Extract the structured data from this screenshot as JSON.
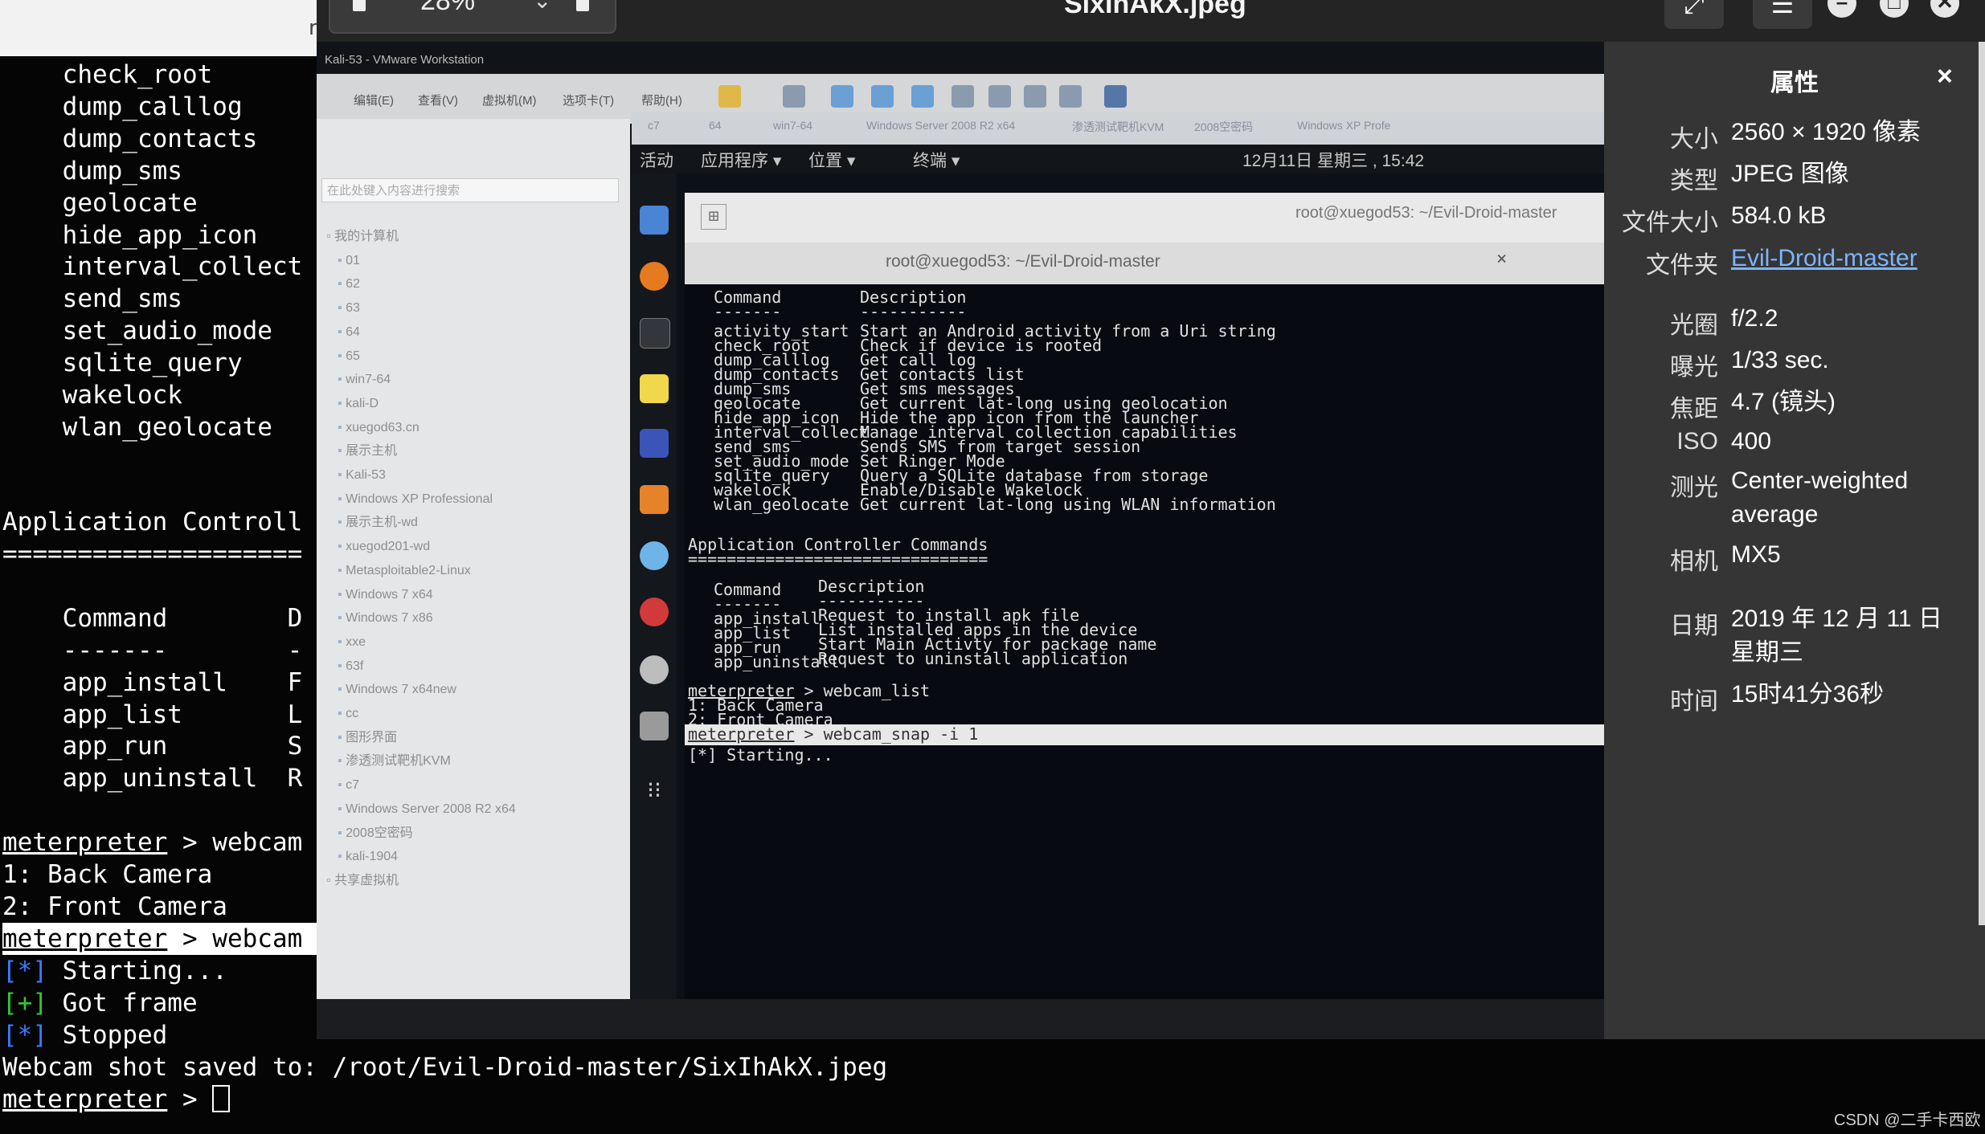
{
  "terminal": {
    "list1": [
      "check_root",
      "dump_calllog",
      "dump_contacts",
      "dump_sms",
      "geolocate",
      "hide_app_icon",
      "interval_collect",
      "send_sms",
      "set_audio_mode",
      "sqlite_query",
      "wakelock",
      "wlan_geolocate"
    ],
    "section": "Application Controll",
    "divider": "====================",
    "col_command": "Command",
    "col_desc_initial": "D",
    "col_underline": "-------",
    "col_desc_underline": "-",
    "apps": [
      {
        "cmd": "app_install",
        "d": "F"
      },
      {
        "cmd": "app_list",
        "d": "L"
      },
      {
        "cmd": "app_run",
        "d": "S"
      },
      {
        "cmd": "app_uninstall",
        "d": "R"
      }
    ],
    "prompt": "meterpreter",
    "webcam_cmd": " > webcam",
    "cam1": "1: Back Camera",
    "cam2": "2: Front Camera",
    "starting_tag": "[*]",
    "starting": " Starting...",
    "got_tag": "[+]",
    "got": " Got frame",
    "stopped_tag": "[*]",
    "stopped": " Stopped",
    "saved": "Webcam shot saved to: /root/Evil-Droid-master/SixIhAkX.jpeg",
    "final_prompt_suffix": " > ",
    "r_char": "r"
  },
  "viewer": {
    "zoom": "28%",
    "zoom_chevron": "⌄",
    "title": "SixIhAkX.jpeg",
    "btn_fullscreen": "⤢",
    "btn_menu": "☰",
    "btn_min": "–",
    "btn_max": "□",
    "btn_close": "✕"
  },
  "photo": {
    "vm_title": "Kali-53 - VMware Workstation",
    "menu": [
      "编辑(E)",
      "查看(V)",
      "虚拟机(M)",
      "选项卡(T)",
      "帮助(H)"
    ],
    "lib_search": "在此处键入内容进行搜索",
    "tree_root": "我的计算机",
    "tree": [
      "01",
      "62",
      "63",
      "64",
      "65",
      "win7-64",
      "kali-D",
      "xuegod63.cn",
      "展示主机",
      "Kali-53",
      "Windows XP Professional",
      "展示主机-wd",
      "xuegod201-wd",
      "Metasploitable2-Linux",
      "Windows 7 x64",
      "Windows 7 x86",
      "xxe",
      "63f",
      "Windows 7 x64new",
      "cc",
      "图形界面",
      "渗透测试靶机KVM",
      "c7",
      "Windows Server 2008 R2 x64",
      "2008空密码",
      "kali-1904"
    ],
    "tree_shared": "共享虚拟机",
    "tabs": [
      "c7",
      "64",
      "win7-64",
      "Windows Server 2008 R2 x64",
      "渗透测试靶机KVM",
      "2008空密码",
      "Windows XP Profe"
    ],
    "kali_activities": "活动",
    "kali_apps": "应用程序 ▾",
    "kali_places": "位置 ▾",
    "kali_term": "终端 ▾",
    "kali_clock": "12月11日 星期三 , 15:42",
    "term_title_back": "root@xuegod53: ~/Evil-Droid-master",
    "term_title_front": "root@xuegod53: ~/Evil-Droid-master",
    "term_close": "×",
    "plus": "⊞",
    "hdr_command": "Command",
    "hdr_desc": "Description",
    "underline_cmd": "-------",
    "underline_desc": "-----------",
    "cmds": [
      {
        "c": "activity_start",
        "d": "Start an Android activity from a Uri string"
      },
      {
        "c": "check_root",
        "d": "Check if device is rooted"
      },
      {
        "c": "dump_calllog",
        "d": "Get call log"
      },
      {
        "c": "dump_contacts",
        "d": "Get contacts list"
      },
      {
        "c": "dump_sms",
        "d": "Get sms messages"
      },
      {
        "c": "geolocate",
        "d": "Get current lat-long using geolocation"
      },
      {
        "c": "hide_app_icon",
        "d": "Hide the app icon from the launcher"
      },
      {
        "c": "interval_collect",
        "d": "Manage interval collection capabilities"
      },
      {
        "c": "send_sms",
        "d": "Sends SMS from target session"
      },
      {
        "c": "set_audio_mode",
        "d": "Set Ringer Mode"
      },
      {
        "c": "sqlite_query",
        "d": "Query a SQLite database from storage"
      },
      {
        "c": "wakelock",
        "d": "Enable/Disable Wakelock"
      },
      {
        "c": "wlan_geolocate",
        "d": "Get current lat-long using WLAN information"
      }
    ],
    "app_section": "Application Controller Commands",
    "app_divider": "===============================",
    "apps": [
      {
        "c": "app_install",
        "d": "Request to install apk file"
      },
      {
        "c": "app_list",
        "d": "List installed apps in the device"
      },
      {
        "c": "app_run",
        "d": "Start Main Activty for package name"
      },
      {
        "c": "app_uninstall",
        "d": "Request to uninstall application"
      }
    ],
    "prompt": "meterpreter",
    "webcam_list": " > webcam_list",
    "cam1": "1: Back Camera",
    "cam2": "2: Front Camera",
    "snap": " > webcam_snap -i 1",
    "starting": "[*] Starting..."
  },
  "properties": {
    "heading": "属性",
    "close": "×",
    "rows": [
      {
        "k": "大小",
        "v": "2560 × 1920 像素"
      },
      {
        "k": "类型",
        "v": "JPEG 图像"
      },
      {
        "k": "文件大小",
        "v": "584.0 kB"
      },
      {
        "k": "文件夹",
        "v": "Evil-Droid-master"
      },
      {
        "k": "光圈",
        "v": "f/2.2"
      },
      {
        "k": "曝光",
        "v": "1/33 sec."
      },
      {
        "k": "焦距",
        "v": "4.7 (镜头)"
      },
      {
        "k": "ISO",
        "v": "400"
      },
      {
        "k": "测光",
        "v": "Center-weighted average"
      },
      {
        "k": "相机",
        "v": "MX5"
      },
      {
        "k": "日期",
        "v": "2019 年 12 月 11 日 星期三"
      },
      {
        "k": "时间",
        "v": "15时41分36秒"
      }
    ]
  },
  "watermark": "CSDN @二手卡西欧"
}
